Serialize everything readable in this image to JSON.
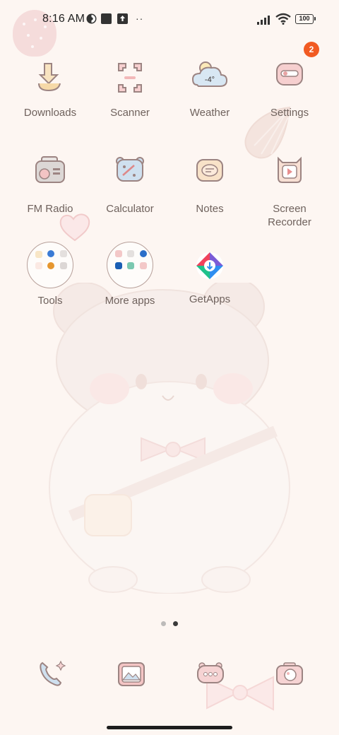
{
  "status_bar": {
    "time": "8:16 AM",
    "overflow": "··",
    "battery": "100",
    "icons": [
      "notification-icon",
      "app-square-icon",
      "upload-icon",
      "signal-icon",
      "wifi-icon",
      "battery-icon"
    ]
  },
  "apps": [
    {
      "label": "Downloads",
      "icon": "download-icon"
    },
    {
      "label": "Scanner",
      "icon": "scanner-icon"
    },
    {
      "label": "Weather",
      "icon": "weather-icon",
      "icon_text": "-4°"
    },
    {
      "label": "Settings",
      "icon": "settings-icon",
      "badge": "2"
    },
    {
      "label": "FM Radio",
      "icon": "radio-icon"
    },
    {
      "label": "Calculator",
      "icon": "calculator-icon"
    },
    {
      "label": "Notes",
      "icon": "notes-icon"
    },
    {
      "label": "Screen Recorder",
      "icon": "screen-recorder-icon"
    },
    {
      "label": "Tools",
      "icon": "folder-icon"
    },
    {
      "label": "More apps",
      "icon": "folder-icon"
    },
    {
      "label": "GetApps",
      "icon": "getapps-icon"
    }
  ],
  "page_indicator": {
    "pages": 2,
    "current": 2
  },
  "dock": [
    {
      "icon": "phone-icon"
    },
    {
      "icon": "gallery-icon"
    },
    {
      "icon": "messages-icon"
    },
    {
      "icon": "camera-icon"
    }
  ],
  "colors": {
    "background": "#fdf6f2",
    "label": "#6f625d",
    "badge": "#f15a22",
    "icon_pink": "#f2c7c7",
    "icon_outline": "#9c8482"
  }
}
